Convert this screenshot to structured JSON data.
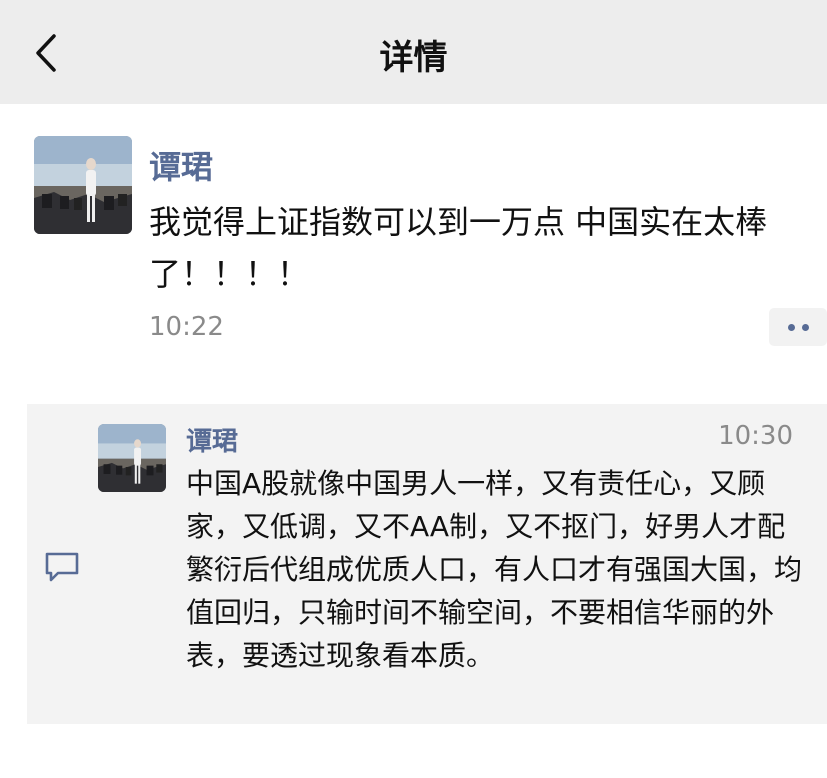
{
  "header": {
    "title": "详情",
    "back_icon": "chevron-left-icon",
    "background": "#ededed"
  },
  "post": {
    "author": "谭珺",
    "text": "我觉得上证指数可以到一万点 中国实在太棒了！！！！",
    "time": "10:22",
    "more_icon": "more-dots-icon"
  },
  "comments": [
    {
      "author": "谭珺",
      "time": "10:30",
      "text": "中国A股就像中国男人一样，又有责任心，又顾家，又低调，又不AA制，又不抠门，好男人才配繁衍后代组成优质人口，有人口才有强国大国，均值回归，只输时间不输空间，不要相信华丽的外表，要透过现象看本质。"
    }
  ],
  "comment_icon": "comment-bubble-icon",
  "colors": {
    "name": "#576b95",
    "time": "#8a8a8a",
    "comment_bg": "#f3f3f3"
  }
}
